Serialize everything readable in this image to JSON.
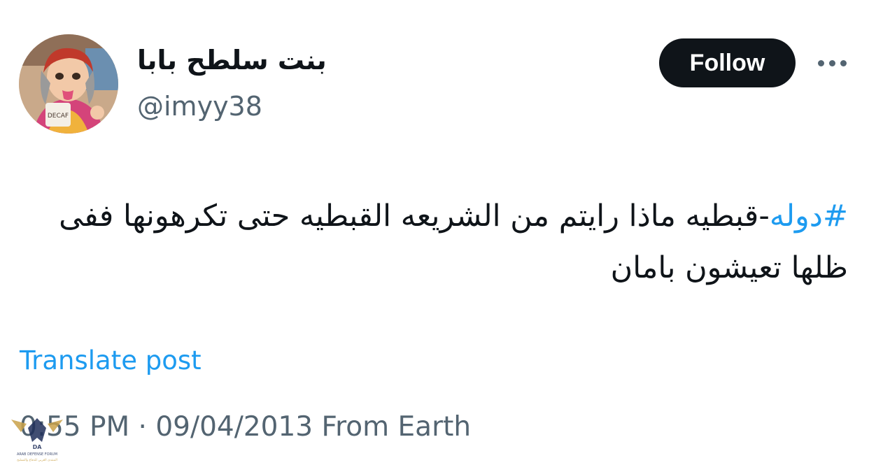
{
  "author": {
    "display_name": "بنت سلطح بابا",
    "handle": "@imyy38",
    "avatar_icon": "profile-avatar-illustration",
    "avatar_mug_text": "DECAF"
  },
  "actions": {
    "follow_label": "Follow",
    "more_icon": "ellipsis-icon"
  },
  "post": {
    "hashtag": "#دوله",
    "text_rest": "-قبطيه ماذا رايتم من الشريعه القبطيه حتى تكرهونها ففى ظلها تعيشون بامان"
  },
  "translate_label": "Translate post",
  "meta": {
    "line": "0:55 PM · 09/04/2013 From Earth"
  },
  "watermark": {
    "title": "ARAB DEFENSE FORUM",
    "subtitle": "المنتدى العربي للدفاع والتسليح",
    "logo_text": "DA"
  },
  "colors": {
    "accent": "#1d9bf0",
    "text_primary": "#0f1419",
    "text_secondary": "#536471",
    "button_bg": "#0f1419"
  }
}
